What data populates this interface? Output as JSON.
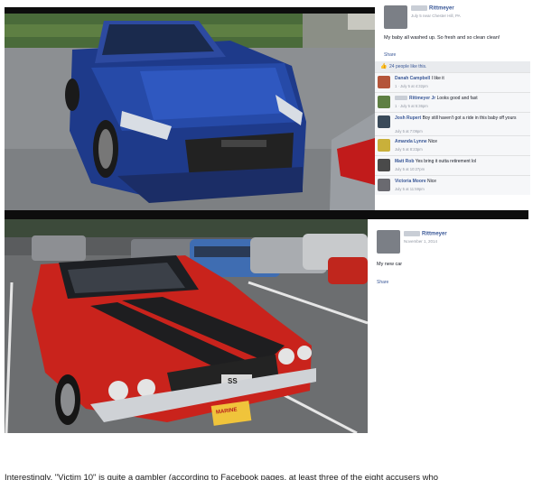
{
  "post1": {
    "author": "Rittmeyer",
    "meta": "July 5 near Chester Hill, PA",
    "text": "My baby all washed up. So fresh and so clean clean!",
    "share": "Share",
    "likes": "24 people like this.",
    "comments": [
      {
        "name": "Danah Campbell",
        "text": "I like it",
        "time": "1 · July 5 at 4:32pm"
      },
      {
        "name": "Rittmeyer Jr",
        "text": "Looks good and fast",
        "time": "1 · July 5 at 5:36pm"
      },
      {
        "name": "Josh Rupert",
        "text": "Boy still haven't got a ride in this baby off yours",
        "time": "July 5 at 7:09pm"
      },
      {
        "name": "Amanda Lynne",
        "text": "Nice",
        "time": "July 5 at 8:23pm"
      },
      {
        "name": "Matt Rob",
        "text": "Yes bring it outta retirement lol",
        "time": "July 5 at 10:27pm"
      },
      {
        "name": "Victoria Moore",
        "text": "Nice",
        "time": "July 5 at 11:59pm"
      }
    ]
  },
  "post2": {
    "author": "Rittmeyer",
    "meta": "November 1, 2014",
    "text": "My new car",
    "share": "Share"
  },
  "plate_text": "SS",
  "plate_label": "MARINE",
  "article_text": "Interestingly, \"Victim 10\" is quite a gambler (according to Facebook pages, at least three of the eight accusers who"
}
